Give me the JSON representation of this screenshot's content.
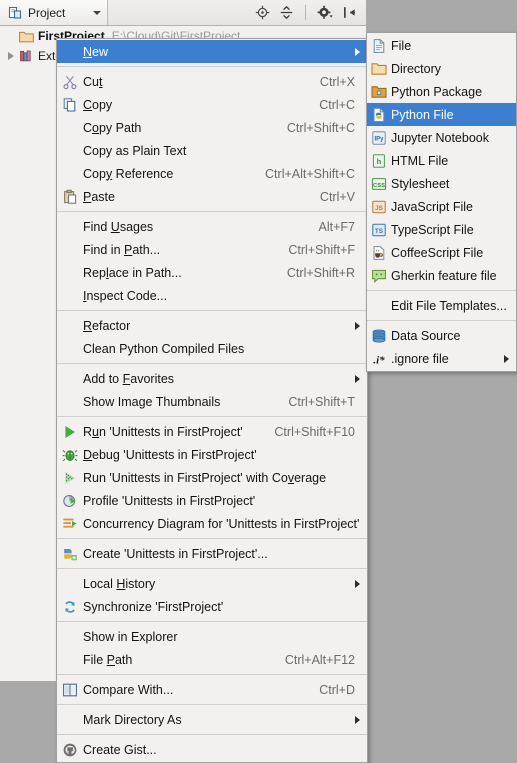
{
  "toolbar": {
    "tab_label": "Project",
    "icons": [
      {
        "name": "locate-icon",
        "title": "Select Opened File"
      },
      {
        "name": "collapse-all-icon",
        "title": "Collapse All"
      },
      {
        "name": "settings-gear-icon",
        "title": "Settings"
      },
      {
        "name": "hide-panel-icon",
        "title": "Hide"
      }
    ]
  },
  "tree": {
    "nodes": [
      {
        "label": "FirstProject",
        "path": "E:\\Cloud\\Git\\FirstProject",
        "icon": "folder-icon",
        "expanded": true
      },
      {
        "label": "External Libraries",
        "path": "",
        "icon": "library-books-icon",
        "expanded": false
      }
    ]
  },
  "context_menu": {
    "groups": [
      {
        "items": [
          {
            "label": "New",
            "accel": "",
            "icon": "",
            "submenu": true,
            "selected": true,
            "mnemonic": "N"
          }
        ]
      },
      {
        "items": [
          {
            "label": "Cut",
            "accel": "Ctrl+X",
            "icon": "scissors-icon",
            "submenu": false,
            "mnemonic": "t"
          },
          {
            "label": "Copy",
            "accel": "Ctrl+C",
            "icon": "copy-icon",
            "submenu": false,
            "mnemonic": "C"
          },
          {
            "label": "Copy Path",
            "accel": "Ctrl+Shift+C",
            "icon": "",
            "submenu": false,
            "mnemonic": "o"
          },
          {
            "label": "Copy as Plain Text",
            "accel": "",
            "icon": "",
            "submenu": false,
            "mnemonic": ""
          },
          {
            "label": "Copy Reference",
            "accel": "Ctrl+Alt+Shift+C",
            "icon": "",
            "submenu": false,
            "mnemonic": "y"
          },
          {
            "label": "Paste",
            "accel": "Ctrl+V",
            "icon": "paste-icon",
            "submenu": false,
            "mnemonic": "P"
          }
        ]
      },
      {
        "items": [
          {
            "label": "Find Usages",
            "accel": "Alt+F7",
            "icon": "",
            "submenu": false,
            "mnemonic": "U"
          },
          {
            "label": "Find in Path...",
            "accel": "Ctrl+Shift+F",
            "icon": "",
            "submenu": false,
            "mnemonic": "P"
          },
          {
            "label": "Replace in Path...",
            "accel": "Ctrl+Shift+R",
            "icon": "",
            "submenu": false,
            "mnemonic": "l"
          },
          {
            "label": "Inspect Code...",
            "accel": "",
            "icon": "",
            "submenu": false,
            "mnemonic": "I"
          }
        ]
      },
      {
        "items": [
          {
            "label": "Refactor",
            "accel": "",
            "icon": "",
            "submenu": true,
            "mnemonic": "R"
          },
          {
            "label": "Clean Python Compiled Files",
            "accel": "",
            "icon": "",
            "submenu": false,
            "mnemonic": ""
          }
        ]
      },
      {
        "items": [
          {
            "label": "Add to Favorites",
            "accel": "",
            "icon": "",
            "submenu": true,
            "mnemonic": "F"
          },
          {
            "label": "Show Image Thumbnails",
            "accel": "Ctrl+Shift+T",
            "icon": "",
            "submenu": false,
            "mnemonic": ""
          }
        ]
      },
      {
        "items": [
          {
            "label": "Run 'Unittests in FirstProject'",
            "accel": "Ctrl+Shift+F10",
            "icon": "run-play-icon",
            "submenu": false,
            "mnemonic": "u"
          },
          {
            "label": "Debug 'Unittests in FirstProject'",
            "accel": "",
            "icon": "debug-bug-icon",
            "submenu": false,
            "mnemonic": "D"
          },
          {
            "label": "Run 'Unittests in FirstProject' with Coverage",
            "accel": "",
            "icon": "coverage-icon",
            "submenu": false,
            "mnemonic": "v"
          },
          {
            "label": "Profile 'Unittests in FirstProject'",
            "accel": "",
            "icon": "profile-icon",
            "submenu": false,
            "mnemonic": ""
          },
          {
            "label": "Concurrency Diagram for  'Unittests in FirstProject'",
            "accel": "",
            "icon": "concurrency-icon",
            "submenu": false,
            "mnemonic": ""
          }
        ]
      },
      {
        "items": [
          {
            "label": "Create 'Unittests in FirstProject'...",
            "accel": "",
            "icon": "create-config-icon",
            "submenu": false,
            "mnemonic": ""
          }
        ]
      },
      {
        "items": [
          {
            "label": "Local History",
            "accel": "",
            "icon": "",
            "submenu": true,
            "mnemonic": "H"
          },
          {
            "label": "Synchronize 'FirstProject'",
            "accel": "",
            "icon": "sync-icon",
            "submenu": false,
            "mnemonic": ""
          }
        ]
      },
      {
        "items": [
          {
            "label": "Show in Explorer",
            "accel": "",
            "icon": "",
            "submenu": false,
            "mnemonic": ""
          },
          {
            "label": "File Path",
            "accel": "Ctrl+Alt+F12",
            "icon": "",
            "submenu": false,
            "mnemonic": "P"
          }
        ]
      },
      {
        "items": [
          {
            "label": "Compare With...",
            "accel": "Ctrl+D",
            "icon": "compare-icon",
            "submenu": false,
            "mnemonic": ""
          }
        ]
      },
      {
        "items": [
          {
            "label": "Mark Directory As",
            "accel": "",
            "icon": "",
            "submenu": true,
            "mnemonic": ""
          }
        ]
      },
      {
        "items": [
          {
            "label": "Create Gist...",
            "accel": "",
            "icon": "gist-github-icon",
            "submenu": false,
            "mnemonic": ""
          }
        ]
      }
    ]
  },
  "new_submenu": {
    "groups": [
      {
        "items": [
          {
            "label": "File",
            "icon": "file-icon",
            "submenu": false,
            "selected": false
          },
          {
            "label": "Directory",
            "icon": "directory-folder-icon",
            "submenu": false,
            "selected": false
          },
          {
            "label": "Python Package",
            "icon": "python-package-icon",
            "submenu": false,
            "selected": false
          },
          {
            "label": "Python File",
            "icon": "python-file-icon",
            "submenu": false,
            "selected": true
          },
          {
            "label": "Jupyter Notebook",
            "icon": "jupyter-notebook-icon",
            "submenu": false,
            "selected": false
          },
          {
            "label": "HTML File",
            "icon": "html-file-icon",
            "submenu": false,
            "selected": false
          },
          {
            "label": "Stylesheet",
            "icon": "css-file-icon",
            "submenu": false,
            "selected": false
          },
          {
            "label": "JavaScript File",
            "icon": "javascript-file-icon",
            "submenu": false,
            "selected": false
          },
          {
            "label": "TypeScript File",
            "icon": "typescript-file-icon",
            "submenu": false,
            "selected": false
          },
          {
            "label": "CoffeeScript File",
            "icon": "coffeescript-file-icon",
            "submenu": false,
            "selected": false
          },
          {
            "label": "Gherkin feature file",
            "icon": "gherkin-file-icon",
            "submenu": false,
            "selected": false
          }
        ]
      },
      {
        "items": [
          {
            "label": "Edit File Templates...",
            "icon": "",
            "submenu": false,
            "selected": false
          }
        ]
      },
      {
        "items": [
          {
            "label": "Data Source",
            "icon": "data-source-icon",
            "submenu": false,
            "selected": false
          },
          {
            "label": ".ignore file",
            "icon": "ignore-file-icon",
            "submenu": true,
            "selected": false
          }
        ]
      }
    ]
  },
  "colors": {
    "selection_blue": "#3c7fd0",
    "menu_background": "#f2f1f0",
    "desktop_gray": "#a9a9a9",
    "accel_gray": "#6a6a6a"
  }
}
